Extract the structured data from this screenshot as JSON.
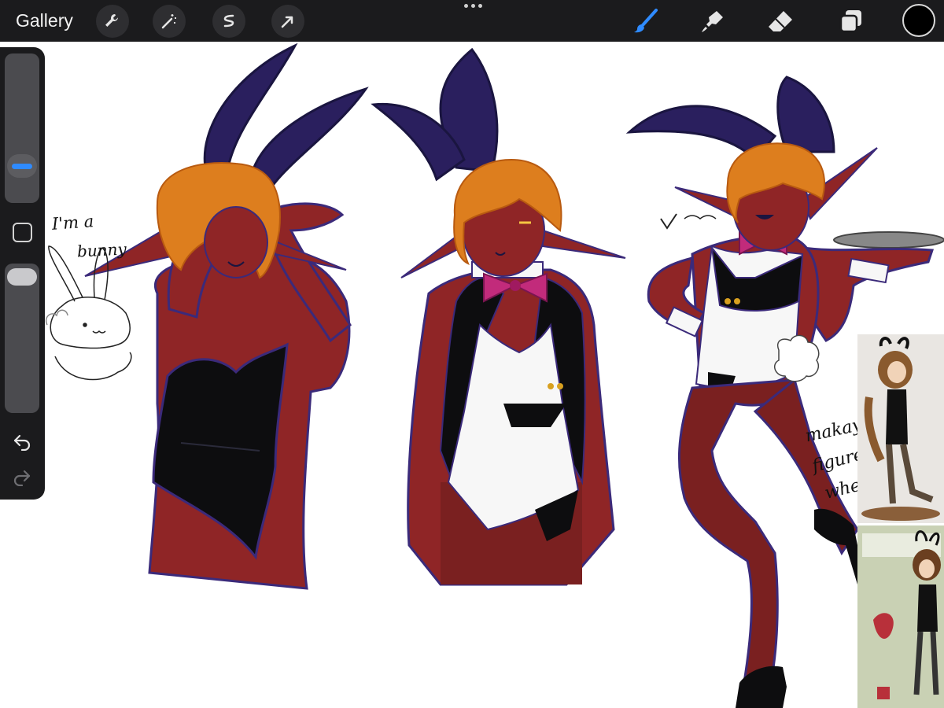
{
  "toolbar": {
    "gallery_label": "Gallery",
    "tools": [
      "wrench-icon",
      "magic-wand-icon",
      "selection-icon",
      "transform-arrow-icon"
    ],
    "right_tools": [
      "brush-icon",
      "smudge-icon",
      "eraser-icon",
      "layers-icon"
    ],
    "active_tool": "brush-icon",
    "accent_color": "#2f8bff",
    "current_color": "#000000"
  },
  "sidebar": {
    "size_slider": "brush-size-slider",
    "opacity_slider": "brush-opacity-slider"
  },
  "canvas": {
    "notes": {
      "line1": "I'm a",
      "line2": "bunny",
      "line3": "makayla",
      "line4": "figure",
      "line5": "when"
    }
  },
  "colors": {
    "skin": "#8f2526",
    "hair": "#dd7e1e",
    "ears": "#2a1f5e",
    "suit": "#0d0d0f",
    "bow": "#c22b7b",
    "vest": "#f7f7f7",
    "tights": "#7a2020"
  }
}
